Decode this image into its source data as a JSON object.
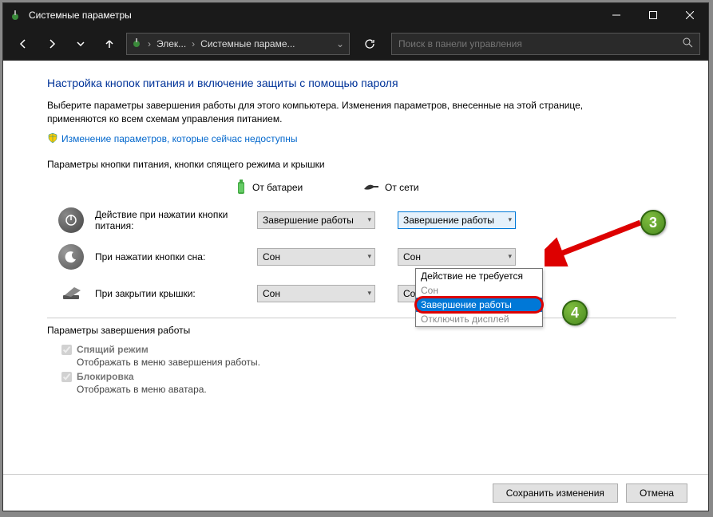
{
  "window": {
    "title": "Системные параметры"
  },
  "toolbar": {
    "crumb1": "Элек...",
    "crumb2": "Системные параме...",
    "search_placeholder": "Поиск в панели управления"
  },
  "heading": "Настройка кнопок питания и включение защиты с помощью пароля",
  "description": "Выберите параметры завершения работы для этого компьютера. Изменения параметров, внесенные на этой странице, применяются ко всем схемам управления питанием.",
  "change_link": "Изменение параметров, которые сейчас недоступны",
  "section1_label": "Параметры кнопки питания, кнопки спящего режима и крышки",
  "col_battery": "От батареи",
  "col_ac": "От сети",
  "rows": {
    "power": {
      "label": "Действие при нажатии кнопки питания:",
      "battery_value": "Завершение работы",
      "ac_value": "Завершение работы"
    },
    "sleep": {
      "label": "При нажатии кнопки сна:",
      "battery_value": "Сон",
      "ac_value": "Сон"
    },
    "lid": {
      "label": "При закрытии крышки:",
      "battery_value": "Сон",
      "ac_value": "Сон"
    }
  },
  "dropdown_options": {
    "opt1": "Действие не требуется",
    "opt2": "Сон",
    "opt3": "Завершение работы",
    "opt4": "Отключить дисплей"
  },
  "section2_label": "Параметры завершения работы",
  "shutdown": {
    "sleep_mode": {
      "label": "Спящий режим",
      "desc": "Отображать в меню завершения работы."
    },
    "lock": {
      "label": "Блокировка",
      "desc": "Отображать в меню аватара."
    }
  },
  "footer": {
    "save": "Сохранить изменения",
    "cancel": "Отмена"
  },
  "annotations": {
    "c3": "3",
    "c4": "4"
  }
}
